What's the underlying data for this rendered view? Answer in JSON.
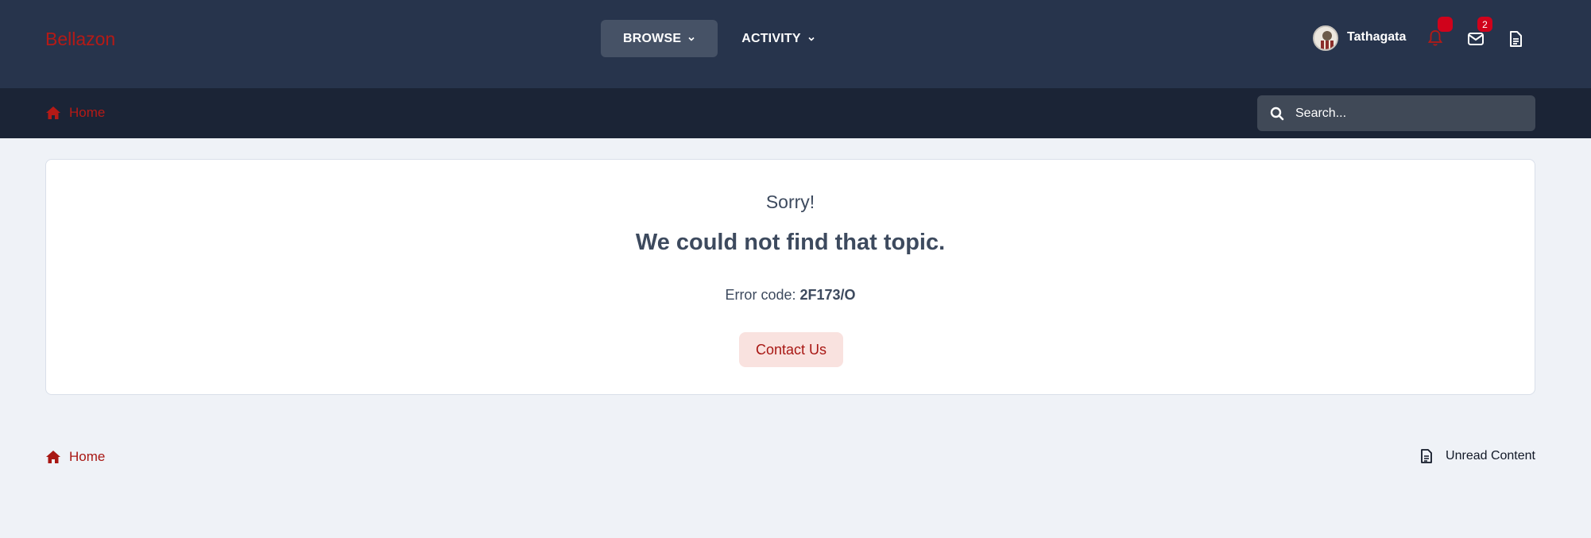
{
  "header": {
    "logo": "Bellazon",
    "nav": [
      {
        "label": "BROWSE",
        "active": true
      },
      {
        "label": "ACTIVITY",
        "active": false
      }
    ],
    "user": {
      "name": "Tathagata"
    },
    "notifications": {
      "count": ""
    },
    "messages": {
      "count": "2"
    }
  },
  "subbar": {
    "breadcrumb": "Home",
    "search": {
      "placeholder": "Search..."
    }
  },
  "error": {
    "title": "Sorry!",
    "message": "We could not find that topic.",
    "code_label": "Error code:",
    "code": "2F173/O",
    "button": "Contact Us"
  },
  "footer": {
    "breadcrumb": "Home",
    "unread": "Unread Content"
  },
  "colors": {
    "header_bg": "#27344c",
    "subbar_bg": "#1b2436",
    "accent": "#b51a16",
    "page_bg": "#eff2f7"
  }
}
